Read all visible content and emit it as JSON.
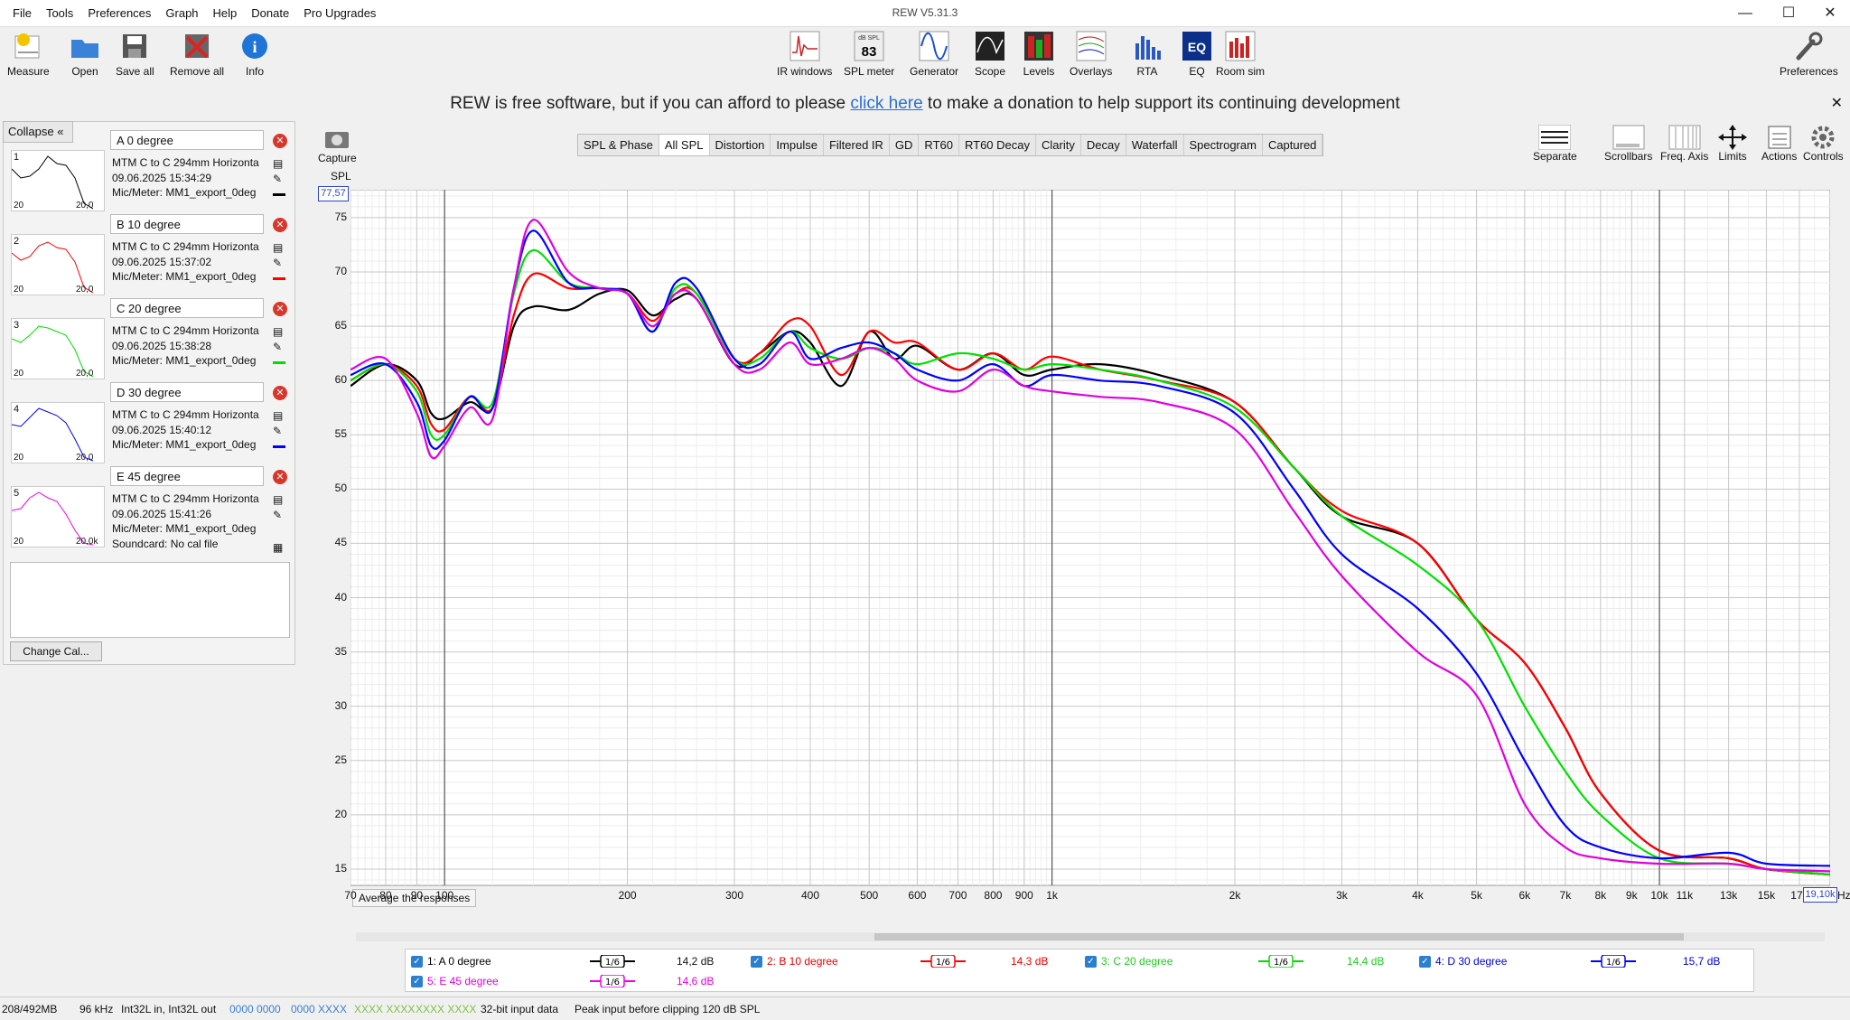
{
  "window": {
    "title": "REW V5.31.3"
  },
  "menu": [
    "File",
    "Tools",
    "Preferences",
    "Graph",
    "Help",
    "Donate",
    "Pro Upgrades"
  ],
  "toolbar": {
    "left": [
      {
        "label": "Measure",
        "icon": "microphone-icon"
      },
      {
        "label": "Open",
        "icon": "folder-icon"
      },
      {
        "label": "Save all",
        "icon": "save-icon"
      },
      {
        "label": "Remove all",
        "icon": "remove-icon"
      },
      {
        "label": "Info",
        "icon": "info-icon"
      }
    ],
    "center": [
      {
        "label": "IR windows",
        "icon": "ir-icon"
      },
      {
        "label": "SPL meter",
        "icon": "spl-meter-icon",
        "badge_top": "dB SPL",
        "badge_value": "83"
      },
      {
        "label": "Generator",
        "icon": "generator-icon"
      },
      {
        "label": "Scope",
        "icon": "scope-icon"
      },
      {
        "label": "Levels",
        "icon": "levels-icon"
      },
      {
        "label": "Overlays",
        "icon": "overlays-icon"
      },
      {
        "label": "RTA",
        "icon": "rta-icon"
      },
      {
        "label": "EQ",
        "icon": "eq-icon"
      },
      {
        "label": "Room sim",
        "icon": "room-sim-icon"
      }
    ],
    "right": {
      "label": "Preferences",
      "icon": "wrench-icon"
    }
  },
  "donation": {
    "before": "REW is free software, but if you can afford to please ",
    "link": "click here",
    "after": " to make a donation to help support its continuing development"
  },
  "panel": {
    "collapse": "Collapse",
    "change_cal": "Change Cal...",
    "measurements": [
      {
        "num": "1",
        "name": "A 0 degree",
        "line1": "MTM C to C 294mm Horizonta",
        "line2": "09.06.2025 15:34:29",
        "line3": "Mic/Meter: MM1_export_0deg",
        "color": "#000000",
        "tick_left": "20",
        "tick_right": "20,0"
      },
      {
        "num": "2",
        "name": "B 10 degree",
        "line1": "MTM C to C 294mm Horizonta",
        "line2": "09.06.2025 15:37:02",
        "line3": "Mic/Meter: MM1_export_0deg",
        "color": "#ff0000",
        "tick_left": "20",
        "tick_right": "20,0"
      },
      {
        "num": "3",
        "name": "C 20 degree",
        "line1": "MTM C to C 294mm Horizonta",
        "line2": "09.06.2025 15:38:28",
        "line3": "Mic/Meter: MM1_export_0deg",
        "color": "#00e000",
        "tick_left": "20",
        "tick_right": "20,0"
      },
      {
        "num": "4",
        "name": "D 30 degree",
        "line1": "MTM C to C 294mm Horizonta",
        "line2": "09.06.2025 15:40:12",
        "line3": "Mic/Meter: MM1_export_0deg",
        "color": "#0000ff",
        "tick_left": "20",
        "tick_right": "20,0"
      },
      {
        "num": "5",
        "name": "E 45 degree",
        "line1": "MTM C to C 294mm Horizonta",
        "line2": "09.06.2025 15:41:26",
        "line3": "Mic/Meter: MM1_export_0deg",
        "line4": "Soundcard: No cal file",
        "color": "#e000e0",
        "tick_left": "20",
        "tick_right": "20,0k"
      }
    ]
  },
  "tabs": [
    "SPL & Phase",
    "All SPL",
    "Distortion",
    "Impulse",
    "Filtered IR",
    "GD",
    "RT60",
    "RT60 Decay",
    "Clarity",
    "Decay",
    "Waterfall",
    "Spectrogram",
    "Captured"
  ],
  "selected_tab": "All SPL",
  "graph_tools": {
    "capture": "Capture",
    "separate": "Separate",
    "scrollbars": "Scrollbars",
    "freq_axis": "Freq. Axis",
    "limits": "Limits",
    "actions": "Actions",
    "controls": "Controls"
  },
  "graph": {
    "y_label": "SPL",
    "y_top": "77,57",
    "x_right": "19,10k",
    "x_unit": "Hz",
    "avg_button": "Average the responses"
  },
  "chart_data": {
    "type": "line",
    "xlabel": "",
    "ylabel": "SPL",
    "x_scale": "log",
    "xlim": [
      70,
      19100
    ],
    "ylim": [
      13.5,
      77.57
    ],
    "grid": true,
    "x_ticks": [
      70,
      80,
      90,
      100,
      200,
      300,
      400,
      500,
      600,
      700,
      800,
      900,
      1000,
      2000,
      3000,
      4000,
      5000,
      6000,
      7000,
      8000,
      9000,
      10000,
      11000,
      13000,
      15000,
      17000
    ],
    "x_tick_labels": [
      "70",
      "80",
      "90",
      "100",
      "200",
      "300",
      "400",
      "500",
      "600",
      "700",
      "800",
      "900",
      "1k",
      "2k",
      "3k",
      "4k",
      "5k",
      "6k",
      "7k",
      "8k",
      "9k",
      "10k",
      "11k",
      "13k",
      "15k",
      "17k"
    ],
    "y_ticks": [
      15,
      20,
      25,
      30,
      35,
      40,
      45,
      50,
      55,
      60,
      65,
      70,
      75
    ],
    "x": [
      70,
      80,
      90,
      95,
      100,
      110,
      120,
      130,
      140,
      160,
      180,
      200,
      220,
      240,
      260,
      300,
      330,
      370,
      400,
      450,
      500,
      550,
      600,
      700,
      800,
      900,
      1000,
      1200,
      1500,
      2000,
      2500,
      3000,
      4000,
      5000,
      6000,
      7000,
      8000,
      10000,
      13000,
      15000,
      19100
    ],
    "series": [
      {
        "name": "1: A 0 degree",
        "color": "#000000",
        "smoothing": "1/6",
        "level": "14,2 dB",
        "values": [
          59.5,
          61.5,
          60,
          57,
          56.5,
          58,
          57.5,
          65,
          66.8,
          66.5,
          68,
          68.3,
          66,
          67.5,
          67.5,
          61.5,
          62.5,
          64.5,
          63.5,
          59.5,
          64.5,
          62,
          63.2,
          61,
          62.5,
          60.5,
          61,
          61.5,
          60.5,
          58,
          52,
          47.5,
          45,
          38,
          34,
          28,
          22,
          16.7,
          16,
          15,
          14.5
        ]
      },
      {
        "name": "2: B 10 degree",
        "color": "#ff0000",
        "smoothing": "1/6",
        "level": "14,3 dB",
        "values": [
          60,
          61.5,
          59.5,
          56,
          55.5,
          58.5,
          57.5,
          66,
          69.8,
          68.5,
          68.5,
          68,
          65.5,
          68,
          68,
          62,
          62.5,
          65.5,
          65,
          60.5,
          64.5,
          63.5,
          63.5,
          61,
          62.5,
          61,
          62.2,
          61,
          60,
          58,
          52,
          48,
          45,
          38,
          34,
          28,
          22,
          16.7,
          16,
          15,
          14.5
        ]
      },
      {
        "name": "3: C 20 degree",
        "color": "#00e000",
        "smoothing": "1/6",
        "level": "14,4 dB",
        "values": [
          60,
          61.5,
          59,
          55,
          55,
          58.5,
          58,
          68,
          72,
          69,
          68.5,
          68,
          64.5,
          68.5,
          68,
          62,
          62,
          64.5,
          63,
          62,
          63,
          62.5,
          61.5,
          62.5,
          62,
          61,
          61.5,
          61,
          60,
          57.5,
          52,
          47.5,
          43,
          38,
          30,
          24,
          20,
          16,
          15.5,
          15,
          14.5
        ]
      },
      {
        "name": "4: D 30 degree",
        "color": "#0000ff",
        "smoothing": "1/6",
        "level": "15,7 dB",
        "values": [
          60.5,
          61.5,
          58,
          54,
          54.5,
          58.5,
          57.5,
          68.5,
          73.8,
          69,
          68.5,
          68,
          64.5,
          69,
          68.5,
          62,
          61.5,
          64.5,
          62,
          63,
          63.5,
          62.5,
          61,
          60,
          61.5,
          59.5,
          60.5,
          60,
          59.5,
          57,
          50,
          44,
          39,
          33,
          25,
          19,
          17,
          16,
          16.5,
          15.5,
          15.3
        ]
      },
      {
        "name": "5: E 45 degree",
        "color": "#e000e0",
        "smoothing": "1/6",
        "level": "14,6 dB",
        "values": [
          61,
          62,
          57,
          53,
          54,
          57.5,
          56.5,
          68.5,
          74.8,
          70,
          68.5,
          68,
          65,
          68,
          67.5,
          61.5,
          61,
          63.5,
          61.5,
          62,
          63,
          62,
          60,
          59,
          61,
          59.5,
          59,
          58.5,
          58,
          55.5,
          48,
          42,
          35,
          31,
          21,
          17,
          16,
          15.5,
          15.5,
          15,
          14.8
        ]
      }
    ]
  },
  "status": [
    "208/492MB",
    "96 kHz",
    "Int32L in, Int32L out",
    "0000 0000",
    "0000 XXXX",
    "XXXX XXXX",
    "XXXX XXXX",
    "32-bit input data",
    "Peak input before clipping 120 dB SPL"
  ]
}
